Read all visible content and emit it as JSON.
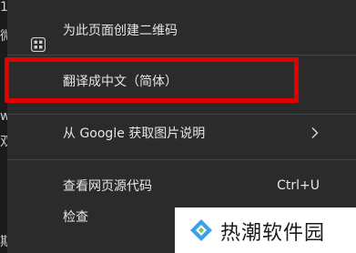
{
  "background_glyphs": [
    "1",
    "微",
    "w",
    "双",
    "期测"
  ],
  "menu": {
    "items": [
      {
        "label": "为此页面创建二维码",
        "icon": "qr-code-icon"
      },
      {
        "label": "翻译成中文（简体）"
      },
      {
        "label": "从 Google 获取图片说明",
        "icon": "chevron-right-icon"
      },
      {
        "label": "查看网页源代码",
        "shortcut": "Ctrl+U"
      },
      {
        "label": "检查"
      }
    ]
  },
  "highlight_color": "#e30000",
  "watermark": {
    "text": "热潮软件园",
    "icon": "watermark-logo-icon"
  }
}
